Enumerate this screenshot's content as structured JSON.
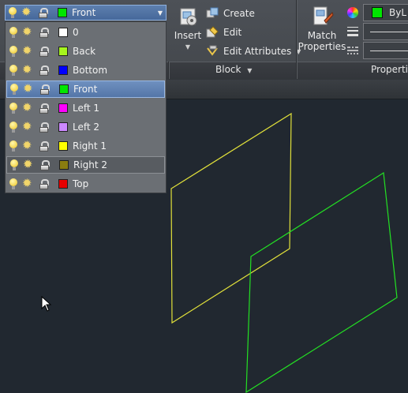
{
  "layer_dropdown": {
    "current": {
      "name": "Front",
      "color": "#00e600"
    },
    "items": [
      {
        "name": "0",
        "color": "#ffffff",
        "state": "normal"
      },
      {
        "name": "Back",
        "color": "#a6f51d",
        "state": "normal"
      },
      {
        "name": "Bottom",
        "color": "#0000ff",
        "state": "normal"
      },
      {
        "name": "Front",
        "color": "#00e600",
        "state": "selected"
      },
      {
        "name": "Left 1",
        "color": "#ff00ff",
        "state": "normal"
      },
      {
        "name": "Left 2",
        "color": "#cc88ff",
        "state": "normal"
      },
      {
        "name": "Right 1",
        "color": "#ffff00",
        "state": "normal"
      },
      {
        "name": "Right 2",
        "color": "#8a7d10",
        "state": "hover"
      },
      {
        "name": "Top",
        "color": "#e60000",
        "state": "normal"
      }
    ]
  },
  "block_panel": {
    "insert_label": "Insert",
    "create_label": "Create",
    "edit_label": "Edit",
    "edit_attributes_label": "Edit Attributes",
    "title": "Block"
  },
  "properties_panel": {
    "match_label_1": "Match",
    "match_label_2": "Properties",
    "color_value": "ByL",
    "color_swatch": "#00e600",
    "title": "Propertie"
  },
  "canvas": {
    "background": "#212830",
    "yellow_line": "#e1e13a",
    "green_line": "#23e023"
  }
}
